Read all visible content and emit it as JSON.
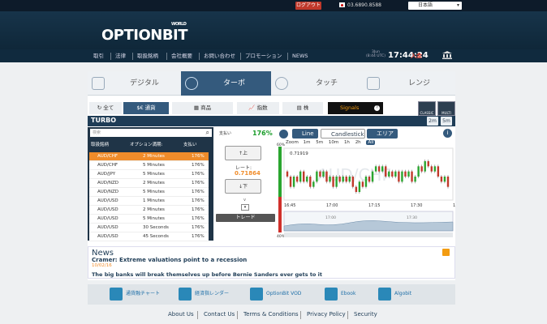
{
  "topbar": {
    "logout": "ログアウト",
    "phone": "03.6890.8588",
    "language": "日本語"
  },
  "logo": {
    "text": "OPTIONBIT",
    "super": "WORLD"
  },
  "nav": [
    "取引",
    "法律",
    "取扱銘柄",
    "会社概要",
    "お問い合わせ",
    "プロモーション",
    "NEWS"
  ],
  "clock": {
    "date_line1": "3Jun",
    "date_line2": "(8:44 UTC)",
    "time": "17:44:24",
    "deposit": "入金"
  },
  "modes": [
    {
      "label": "デジタル",
      "icon": "bar-chart-icon"
    },
    {
      "label": "ターボ",
      "icon": "clock-icon"
    },
    {
      "label": "タッチ",
      "icon": "target-icon"
    },
    {
      "label": "レンジ",
      "icon": "range-icon"
    }
  ],
  "assets": [
    "全て",
    "通貨",
    "商品",
    "指数",
    "株"
  ],
  "signals": "Signals",
  "view_buttons": [
    "CLASSIC",
    "MULTI"
  ],
  "turbo": {
    "title": "TURBO",
    "timeframes": [
      "2m",
      "5m"
    ]
  },
  "search_placeholder": "検索",
  "payout": {
    "label": "支払い",
    "value": "176%"
  },
  "table": {
    "headers": [
      "取扱銘柄",
      "オプション満期:",
      "支払い"
    ],
    "rows": [
      [
        "AUD/CHF",
        "2 Minutes",
        "176%"
      ],
      [
        "AUD/CHF",
        "5 Minutes",
        "176%"
      ],
      [
        "AUD/JPY",
        "5 Minutes",
        "176%"
      ],
      [
        "AUD/NZD",
        "2 Minutes",
        "176%"
      ],
      [
        "AUD/NZD",
        "5 Minutes",
        "176%"
      ],
      [
        "AUD/USD",
        "1 Minutes",
        "176%"
      ],
      [
        "AUD/USD",
        "2 Minutes",
        "176%"
      ],
      [
        "AUD/USD",
        "5 Minutes",
        "176%"
      ],
      [
        "AUD/USD",
        "30 Seconds",
        "176%"
      ],
      [
        "AUD/USD",
        "45 Seconds",
        "176%"
      ]
    ]
  },
  "trade_panel": {
    "up": "上",
    "rate_label": "レート:",
    "rate": "0.71864",
    "down": "下",
    "expand": "v",
    "trade": "トレード"
  },
  "chart_toolbar": {
    "line": "Line",
    "candlestick": "Candlestick",
    "area": "エリア",
    "zoom_label": "Zoom",
    "zooms": [
      "1m",
      "5m",
      "10m",
      "1h",
      "2h",
      "All"
    ]
  },
  "chart_data": {
    "type": "candlestick",
    "watermark": "AUD/CHF",
    "y_labels": [
      "0.71919",
      "0.71833"
    ],
    "x_ticks": [
      "16:45",
      "17:00",
      "17:15",
      "17:30",
      "17:45"
    ],
    "navigator_ticks": [
      "17:00",
      "17:30"
    ],
    "side_labels": [
      "60%",
      "40%"
    ],
    "candles": [
      [
        0.7188,
        0.7187
      ],
      [
        0.7187,
        0.7185
      ],
      [
        0.7185,
        0.7187
      ],
      [
        0.7187,
        0.7186
      ],
      [
        0.7186,
        0.7188
      ],
      [
        0.7188,
        0.7186
      ],
      [
        0.7186,
        0.7187
      ],
      [
        0.7187,
        0.7185
      ],
      [
        0.7185,
        0.7186
      ],
      [
        0.7186,
        0.7188
      ],
      [
        0.7188,
        0.7187
      ],
      [
        0.7187,
        0.7188
      ],
      [
        0.7188,
        0.7186
      ],
      [
        0.7186,
        0.7187
      ],
      [
        0.7187,
        0.7185
      ],
      [
        0.7185,
        0.7187
      ],
      [
        0.7187,
        0.7186
      ],
      [
        0.7186,
        0.7187
      ],
      [
        0.7187,
        0.7186
      ],
      [
        0.7186,
        0.7187
      ],
      [
        0.7187,
        0.7185
      ],
      [
        0.7185,
        0.7184
      ],
      [
        0.7184,
        0.7186
      ],
      [
        0.7186,
        0.7185
      ],
      [
        0.7185,
        0.7187
      ],
      [
        0.7187,
        0.7186
      ],
      [
        0.7186,
        0.7188
      ],
      [
        0.7188,
        0.7189
      ],
      [
        0.7189,
        0.7188
      ],
      [
        0.7188,
        0.7189
      ],
      [
        0.7189,
        0.7187
      ],
      [
        0.7187,
        0.7188
      ],
      [
        0.7188,
        0.7187
      ],
      [
        0.7187,
        0.7188
      ],
      [
        0.7188,
        0.7186
      ],
      [
        0.7186,
        0.7188
      ],
      [
        0.7188,
        0.7187
      ],
      [
        0.7187,
        0.7188
      ],
      [
        0.7188,
        0.7186
      ],
      [
        0.7186,
        0.7187
      ],
      [
        0.7187,
        0.7189
      ],
      [
        0.7189,
        0.7188
      ],
      [
        0.7188,
        0.719
      ],
      [
        0.719,
        0.7189
      ],
      [
        0.7189,
        0.7188
      ],
      [
        0.7188,
        0.7189
      ],
      [
        0.7189,
        0.7187
      ],
      [
        0.7187,
        0.7186
      ],
      [
        0.7186,
        0.7187
      ],
      [
        0.7187,
        0.7185
      ]
    ]
  },
  "news": {
    "title": "News",
    "headline": "Cramer: Extreme valuations point to a recession",
    "date": "10/02/16",
    "headline2": "The big banks will break themselves up before Bernie Sanders ever gets to it"
  },
  "tools": [
    "通貨融チャート",
    "経済指レンダー",
    "OptionBit VOD",
    "Ebook",
    "Algobit"
  ],
  "footer": [
    "About Us",
    "Contact Us",
    "Terms & Conditions",
    "Privacy Policy",
    "Security"
  ]
}
